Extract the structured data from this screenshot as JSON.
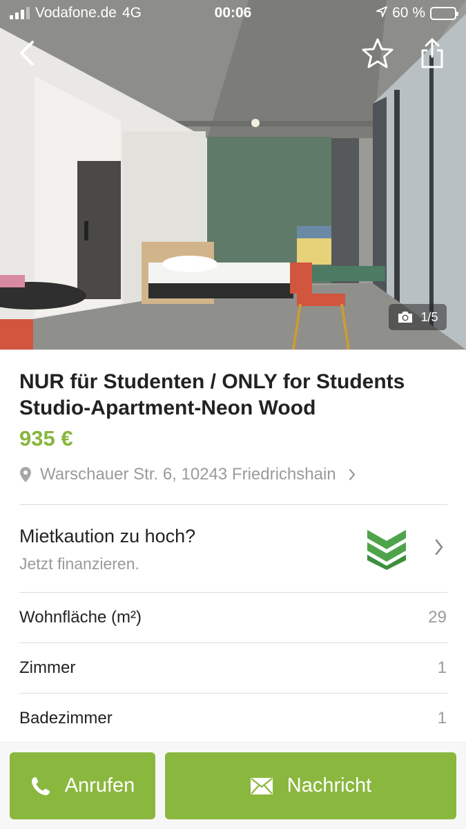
{
  "status_bar": {
    "carrier": "Vodafone.de",
    "network": "4G",
    "time": "00:06",
    "battery": "60 %",
    "battery_level": 0.6
  },
  "header": {
    "icons": [
      "back-arrow-icon",
      "star-icon",
      "share-icon"
    ]
  },
  "gallery": {
    "counter": "1/5",
    "current": 1,
    "total": 5,
    "icon": "camera-icon"
  },
  "listing": {
    "title": "NUR für Studenten / ONLY for Students Studio-Apartment-Neon Wood",
    "price": "935 €",
    "address": "Warschauer Str. 6, 10243 Friedrichshain"
  },
  "finance": {
    "heading": "Mietkaution zu hoch?",
    "subtitle": "Jetzt finanzieren."
  },
  "details": [
    {
      "label": "Wohnfläche (m²)",
      "value": "29"
    },
    {
      "label": "Zimmer",
      "value": "1"
    },
    {
      "label": "Badezimmer",
      "value": "1"
    }
  ],
  "actions": {
    "call_label": "Anrufen",
    "message_label": "Nachricht"
  },
  "colors": {
    "accent": "#86b63c",
    "button": "#8ab83f",
    "muted_text": "#9a9a9a",
    "divider": "#dcdcdc"
  }
}
